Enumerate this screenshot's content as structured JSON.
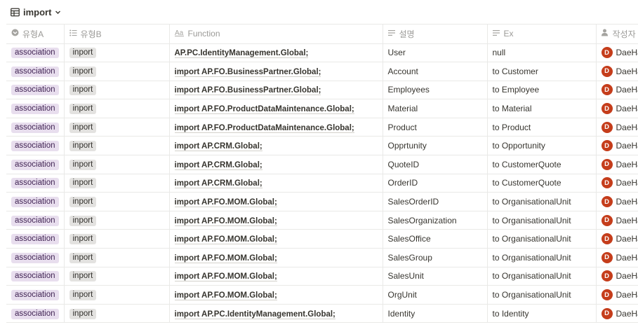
{
  "view": {
    "title": "import",
    "icon": "table-icon",
    "dropdown_icon": "chevron-down-icon"
  },
  "columns": [
    {
      "label": "유형A",
      "icon": "select-icon"
    },
    {
      "label": "유형B",
      "icon": "list-icon"
    },
    {
      "label": "Function",
      "icon": "text-icon"
    },
    {
      "label": "설명",
      "icon": "text-lines-icon"
    },
    {
      "label": "Ex",
      "icon": "text-lines-icon"
    },
    {
      "label": "작성자",
      "icon": "person-icon"
    }
  ],
  "tag_colors": {
    "association_bg": "#e8deee",
    "inport_bg": "#e3e2e0",
    "avatar": "#c53d1b"
  },
  "rows": [
    {
      "typeA": "association",
      "typeB": "inport",
      "function": "AP.PC.IdentityManagement.Global;",
      "desc": "User",
      "ex": "null",
      "author": "DaeHa",
      "avatar": "D"
    },
    {
      "typeA": "association",
      "typeB": "inport",
      "function": "import AP.FO.BusinessPartner.Global;",
      "desc": "Account",
      "ex": "to Customer",
      "author": "DaeHa",
      "avatar": "D"
    },
    {
      "typeA": "association",
      "typeB": "inport",
      "function": "import AP.FO.BusinessPartner.Global;",
      "desc": "Employees",
      "ex": "to Employee",
      "author": "DaeHa",
      "avatar": "D"
    },
    {
      "typeA": "association",
      "typeB": "inport",
      "function": "import AP.FO.ProductDataMaintenance.Global;",
      "desc": "Material",
      "ex": "to Material",
      "author": "DaeHa",
      "avatar": "D"
    },
    {
      "typeA": "association",
      "typeB": "inport",
      "function": "import AP.FO.ProductDataMaintenance.Global;",
      "desc": "Product",
      "ex": "to Product",
      "author": "DaeHa",
      "avatar": "D"
    },
    {
      "typeA": "association",
      "typeB": "inport",
      "function": "import AP.CRM.Global;",
      "desc": "Opprtunity",
      "ex": "to Opportunity",
      "author": "DaeHa",
      "avatar": "D"
    },
    {
      "typeA": "association",
      "typeB": "inport",
      "function": "import AP.CRM.Global;",
      "desc": "QuoteID",
      "ex": "to CustomerQuote",
      "author": "DaeHa",
      "avatar": "D"
    },
    {
      "typeA": "association",
      "typeB": "inport",
      "function": "import AP.CRM.Global;",
      "desc": "OrderID",
      "ex": "to CustomerQuote",
      "author": "DaeHa",
      "avatar": "D"
    },
    {
      "typeA": "association",
      "typeB": "inport",
      "function": "import AP.FO.MOM.Global;",
      "desc": "SalesOrderID",
      "ex": "to OrganisationalUnit",
      "author": "DaeHa",
      "avatar": "D"
    },
    {
      "typeA": "association",
      "typeB": "inport",
      "function": "import AP.FO.MOM.Global;",
      "desc": "SalesOrganization",
      "ex": "to OrganisationalUnit",
      "author": "DaeHa",
      "avatar": "D"
    },
    {
      "typeA": "association",
      "typeB": "inport",
      "function": "import AP.FO.MOM.Global;",
      "desc": "SalesOffice",
      "ex": "to OrganisationalUnit",
      "author": "DaeHa",
      "avatar": "D"
    },
    {
      "typeA": "association",
      "typeB": "inport",
      "function": "import AP.FO.MOM.Global;",
      "desc": "SalesGroup",
      "ex": "to OrganisationalUnit",
      "author": "DaeHa",
      "avatar": "D"
    },
    {
      "typeA": "association",
      "typeB": "inport",
      "function": "import AP.FO.MOM.Global;",
      "desc": "SalesUnit",
      "ex": "to OrganisationalUnit",
      "author": "DaeHa",
      "avatar": "D"
    },
    {
      "typeA": "association",
      "typeB": "inport",
      "function": "import AP.FO.MOM.Global;",
      "desc": "OrgUnit",
      "ex": "to OrganisationalUnit",
      "author": "DaeHa",
      "avatar": "D"
    },
    {
      "typeA": "association",
      "typeB": "inport",
      "function": "import AP.PC.IdentityManagement.Global;",
      "desc": "Identity",
      "ex": "to Identity",
      "author": "DaeHa",
      "avatar": "D"
    }
  ]
}
